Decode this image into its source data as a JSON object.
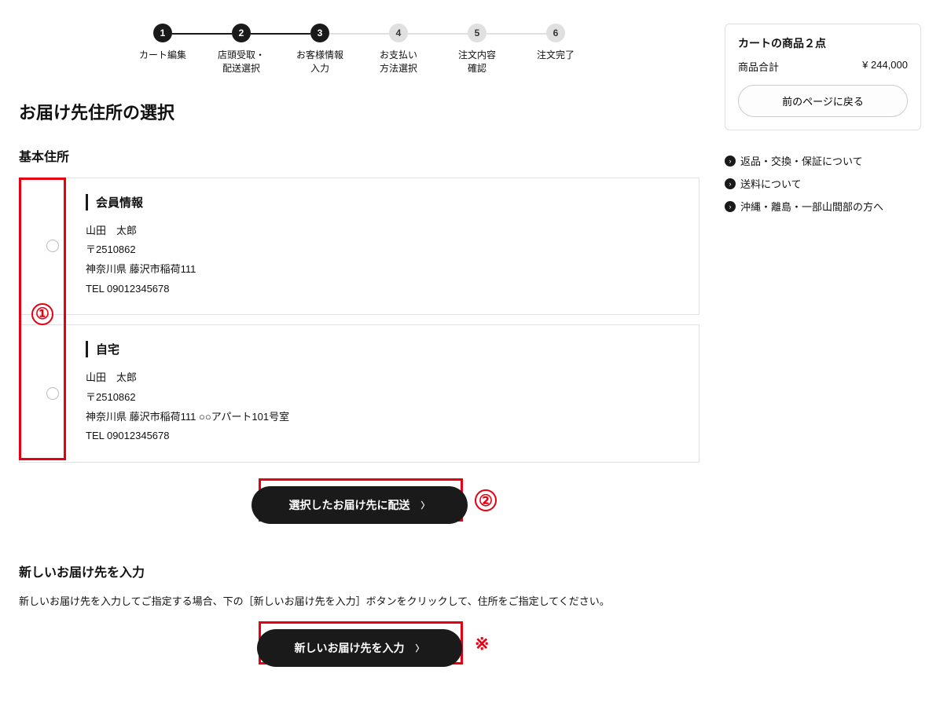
{
  "steps": [
    {
      "num": "1",
      "label": "カート編集",
      "state": "done"
    },
    {
      "num": "2",
      "label": "店頭受取・\n配送選択",
      "state": "done"
    },
    {
      "num": "3",
      "label": "お客様情報\n入力",
      "state": "current"
    },
    {
      "num": "4",
      "label": "お支払い\n方法選択",
      "state": "pending"
    },
    {
      "num": "5",
      "label": "注文内容\n確認",
      "state": "pending"
    },
    {
      "num": "6",
      "label": "注文完了",
      "state": "pending"
    }
  ],
  "page_title": "お届け先住所の選択",
  "basic_address_heading": "基本住所",
  "addresses": [
    {
      "title": "会員情報",
      "name": "山田　太郎",
      "zip": "〒2510862",
      "addr": "神奈川県 藤沢市稲荷111",
      "tel": "TEL 09012345678"
    },
    {
      "title": "自宅",
      "name": "山田　太郎",
      "zip": "〒2510862",
      "addr": "神奈川県 藤沢市稲荷111 ○○アパート101号室",
      "tel": "TEL 09012345678"
    }
  ],
  "cta_deliver_label": "選択したお届け先に配送",
  "new_address_heading": "新しいお届け先を入力",
  "new_address_desc": "新しいお届け先を入力してご指定する場合、下の［新しいお届け先を入力］ボタンをクリックして、住所をご指定してください。",
  "cta_new_label": "新しいお届け先を入力",
  "annotations": {
    "one": "①",
    "two": "②",
    "star": "※"
  },
  "sidebar": {
    "box_title": "カートの商品２点",
    "sum_label": "商品合計",
    "sum_value": "¥ 244,000",
    "back_label": "前のページに戻る",
    "links": [
      "返品・交換・保証について",
      "送料について",
      "沖縄・離島・一部山間部の方へ"
    ]
  }
}
